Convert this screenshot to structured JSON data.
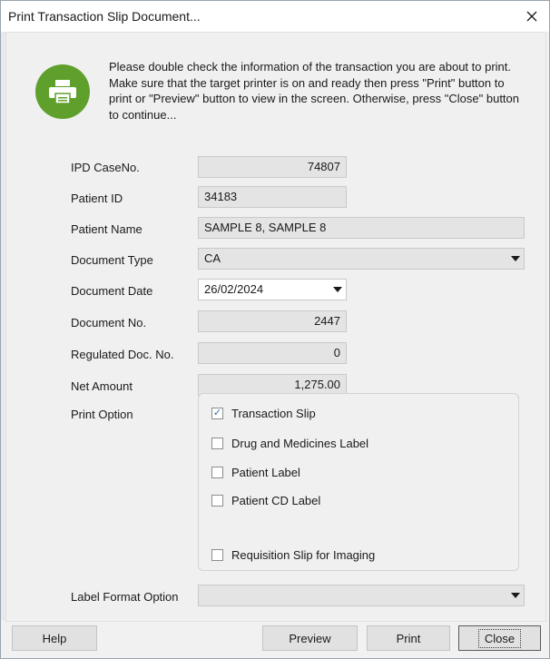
{
  "window": {
    "title": "Print Transaction Slip Document..."
  },
  "header": {
    "icon": "printer-icon",
    "message": "Please double check the information of the transaction you are about to print. Make sure that the target printer is on and ready then press \"Print\" button to print or \"Preview\" button to view in the screen. Otherwise, press \"Close\" button to continue..."
  },
  "form": {
    "ipd_case_no": {
      "label": "IPD CaseNo.",
      "value": "74807"
    },
    "patient_id": {
      "label": "Patient ID",
      "value": "34183"
    },
    "patient_name": {
      "label": "Patient Name",
      "value": "SAMPLE 8, SAMPLE 8"
    },
    "document_type": {
      "label": "Document Type",
      "value": "CA"
    },
    "document_date": {
      "label": "Document Date",
      "value": "26/02/2024"
    },
    "document_no": {
      "label": "Document No.",
      "value": "2447"
    },
    "regulated_doc_no": {
      "label": "Regulated Doc. No.",
      "value": "0"
    },
    "net_amount": {
      "label": "Net Amount",
      "value": "1,275.00"
    },
    "print_option": {
      "label": "Print Option",
      "options": [
        {
          "label": "Transaction Slip",
          "checked": true
        },
        {
          "label": "Drug and Medicines Label",
          "checked": false
        },
        {
          "label": "Patient Label",
          "checked": false
        },
        {
          "label": "Patient CD Label",
          "checked": false
        },
        {
          "label": "Requisition Slip for Imaging",
          "checked": false
        }
      ]
    },
    "label_format_option": {
      "label": "Label Format Option",
      "value": ""
    }
  },
  "buttons": {
    "help": "Help",
    "preview": "Preview",
    "print": "Print",
    "close": "Close"
  },
  "colors": {
    "accent_green": "#5fa02c",
    "window_bg": "#f0f0f0",
    "readonly_field_bg": "#e4e4e4"
  }
}
